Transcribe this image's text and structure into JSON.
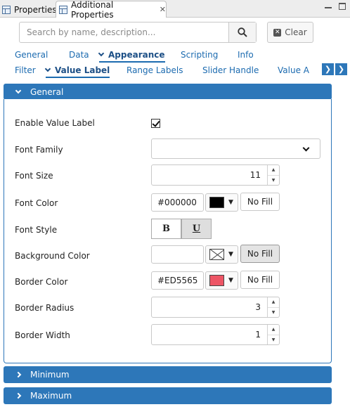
{
  "view_tabs": {
    "properties_label": "Properties",
    "additional_label": "Additional Properties"
  },
  "search": {
    "placeholder": "Search by name, description...",
    "value": "",
    "clear_label": "Clear"
  },
  "nav_primary": [
    "General",
    "Data",
    "Appearance",
    "Scripting",
    "Info"
  ],
  "nav_primary_active": "Appearance",
  "nav_secondary": [
    "Filter",
    "Value Label",
    "Range Labels",
    "Slider Handle",
    "Value A"
  ],
  "nav_secondary_active": "Value Label",
  "sections": {
    "general": "General",
    "minimum": "Minimum",
    "maximum": "Maximum"
  },
  "fields": {
    "enable_value_label": {
      "label": "Enable Value Label",
      "checked": true
    },
    "font_family": {
      "label": "Font Family",
      "value": ""
    },
    "font_size": {
      "label": "Font Size",
      "value": "11"
    },
    "font_color": {
      "label": "Font Color",
      "value": "#000000",
      "swatch": "#000000",
      "nofill_label": "No Fill"
    },
    "font_style": {
      "label": "Font Style",
      "bold": "B",
      "underline": "U"
    },
    "background_color": {
      "label": "Background Color",
      "value": "",
      "nofill_label": "No Fill",
      "nofill_active": true
    },
    "border_color": {
      "label": "Border Color",
      "value": "#ED5565",
      "swatch": "#ED5565",
      "nofill_label": "No Fill"
    },
    "border_radius": {
      "label": "Border Radius",
      "value": "3"
    },
    "border_width": {
      "label": "Border Width",
      "value": "1"
    }
  }
}
